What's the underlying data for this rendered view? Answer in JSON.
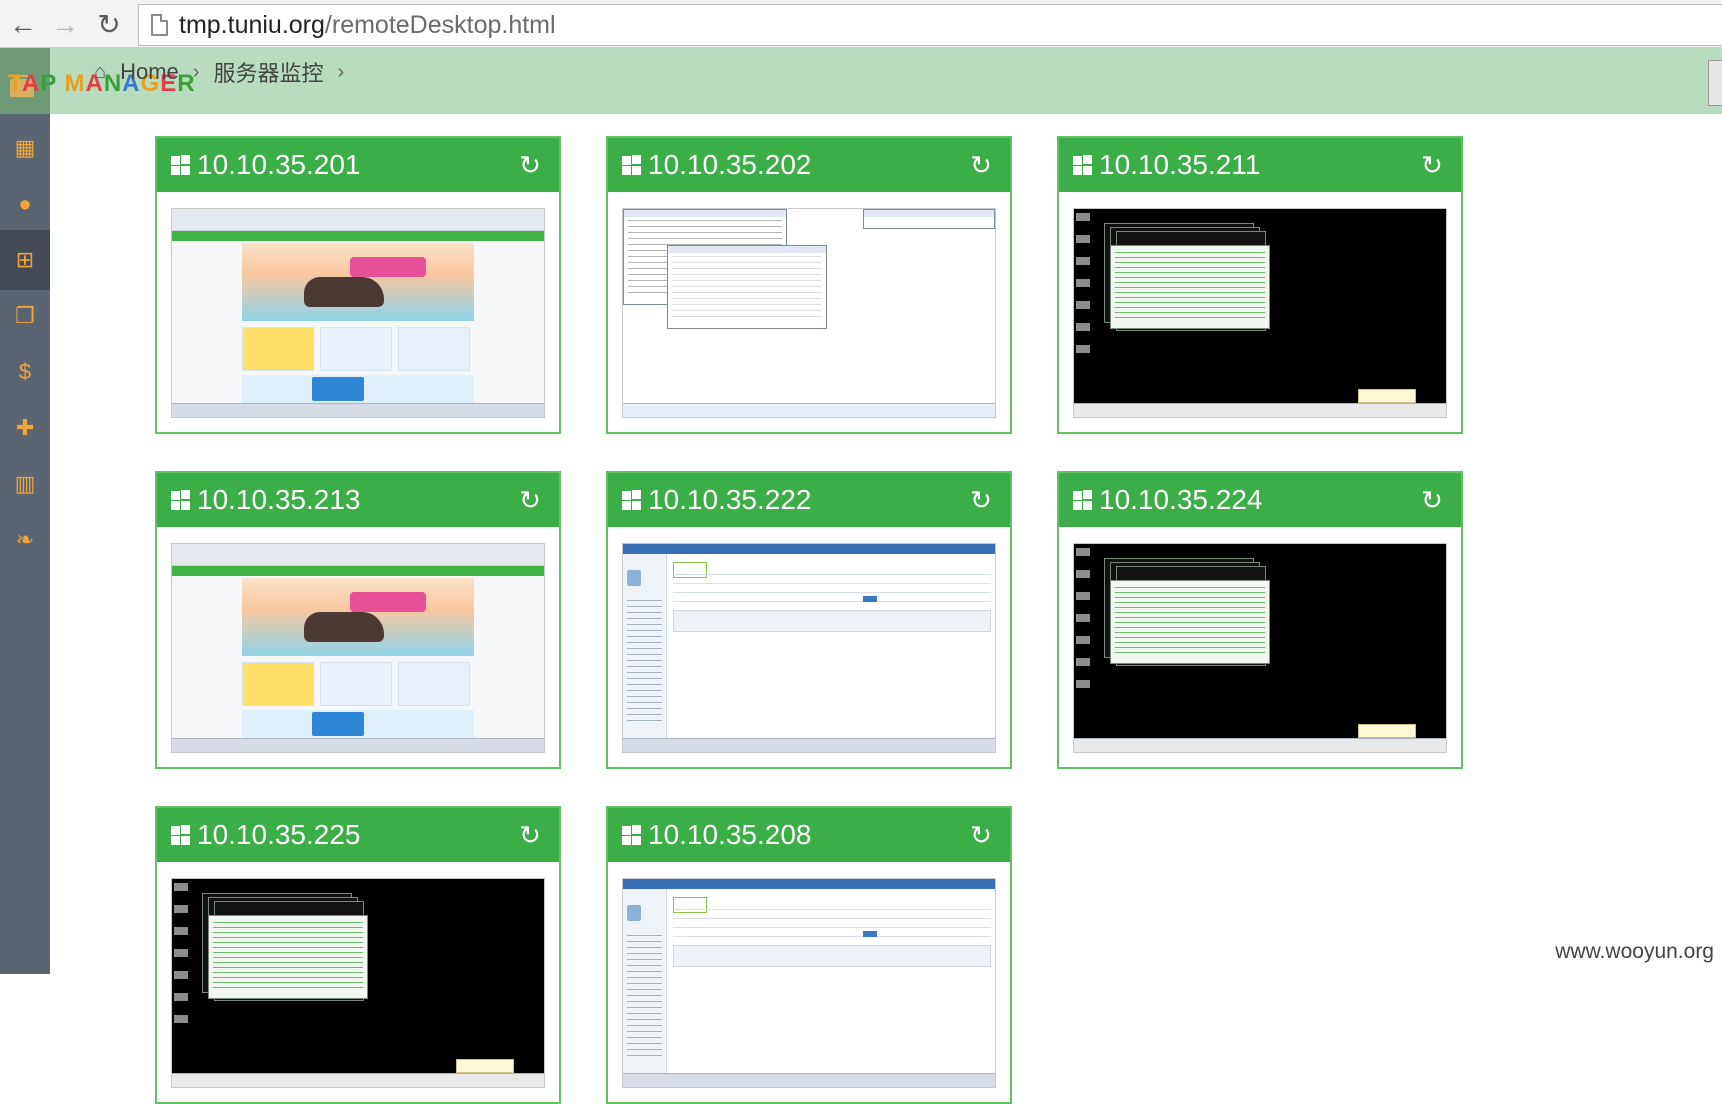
{
  "browser": {
    "url_host": "tmp.tuniu.org",
    "url_path": "/remoteDesktop.html"
  },
  "app": {
    "logo_chars": [
      "T",
      "A",
      "P",
      " ",
      "M",
      "A",
      "N",
      "A",
      "G",
      "E",
      "R"
    ]
  },
  "breadcrumb": {
    "home": "Home",
    "current": "服务器监控"
  },
  "sidebar": {
    "items": [
      {
        "name": "table-icon",
        "glyph": "▦"
      },
      {
        "name": "user-icon",
        "glyph": "●"
      },
      {
        "name": "sitemap-icon",
        "glyph": "⊞"
      },
      {
        "name": "bookmark-icon",
        "glyph": "❐"
      },
      {
        "name": "dollar-icon",
        "glyph": "$"
      },
      {
        "name": "gift-icon",
        "glyph": "✚"
      },
      {
        "name": "bar-chart-icon",
        "glyph": "▥"
      },
      {
        "name": "leaf-icon",
        "glyph": "❧"
      }
    ],
    "active_index": 2
  },
  "servers": [
    {
      "ip": "10.10.35.201",
      "screen": "web"
    },
    {
      "ip": "10.10.35.202",
      "screen": "desk"
    },
    {
      "ip": "10.10.35.211",
      "screen": "term"
    },
    {
      "ip": "10.10.35.213",
      "screen": "web"
    },
    {
      "ip": "10.10.35.222",
      "screen": "admin"
    },
    {
      "ip": "10.10.35.224",
      "screen": "term"
    },
    {
      "ip": "10.10.35.225",
      "screen": "term"
    },
    {
      "ip": "10.10.35.208",
      "screen": "admin"
    }
  ],
  "watermark": "www.wooyun.org"
}
